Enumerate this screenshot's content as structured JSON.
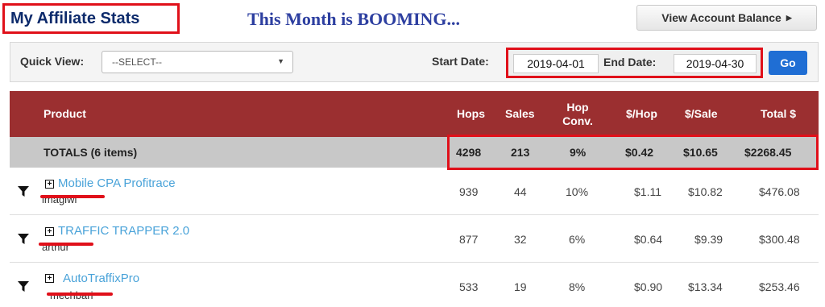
{
  "header": {
    "title": "My Affiliate Stats",
    "headline": "This Month is BOOMING...",
    "account_button": "View Account Balance"
  },
  "filters": {
    "quick_view_label": "Quick View:",
    "quick_view_selected": "--SELECT--",
    "start_label": "Start Date:",
    "start_value": "2019-04-01",
    "end_label": "End Date:",
    "end_value": "2019-04-30",
    "go_label": "Go"
  },
  "table": {
    "columns": {
      "product": "Product",
      "hops": "Hops",
      "sales": "Sales",
      "hop_conv": "Hop Conv.",
      "per_hop": "$/Hop",
      "per_sale": "$/Sale",
      "total": "Total $"
    },
    "totals": {
      "label": "TOTALS (6 items)",
      "hops": "4298",
      "sales": "213",
      "hop_conv": "9%",
      "per_hop": "$0.42",
      "per_sale": "$10.65",
      "total": "$2268.45"
    },
    "rows": [
      {
        "name": "Mobile CPA Profitrace",
        "vendor": "imagiwi",
        "hops": "939",
        "sales": "44",
        "hop_conv": "10%",
        "per_hop": "$1.11",
        "per_sale": "$10.82",
        "total": "$476.08"
      },
      {
        "name": "TRAFFIC TRAPPER 2.0",
        "vendor": "arthur",
        "hops": "877",
        "sales": "32",
        "hop_conv": "6%",
        "per_hop": "$0.64",
        "per_sale": "$9.39",
        "total": "$300.48"
      },
      {
        "name": "AutoTraffixPro",
        "vendor": "mechbari",
        "hops": "533",
        "sales": "19",
        "hop_conv": "8%",
        "per_hop": "$0.90",
        "per_sale": "$13.34",
        "total": "$253.46"
      }
    ]
  },
  "colors": {
    "header_bg": "#9b2f30",
    "totals_bg": "#c8c8c8",
    "link": "#4aa3d9",
    "highlight": "#e0101a",
    "go_button": "#1f6ed4"
  },
  "icons": [
    "filter-icon",
    "expand-plus-icon",
    "caret-right-icon",
    "dropdown-arrow-icon"
  ]
}
